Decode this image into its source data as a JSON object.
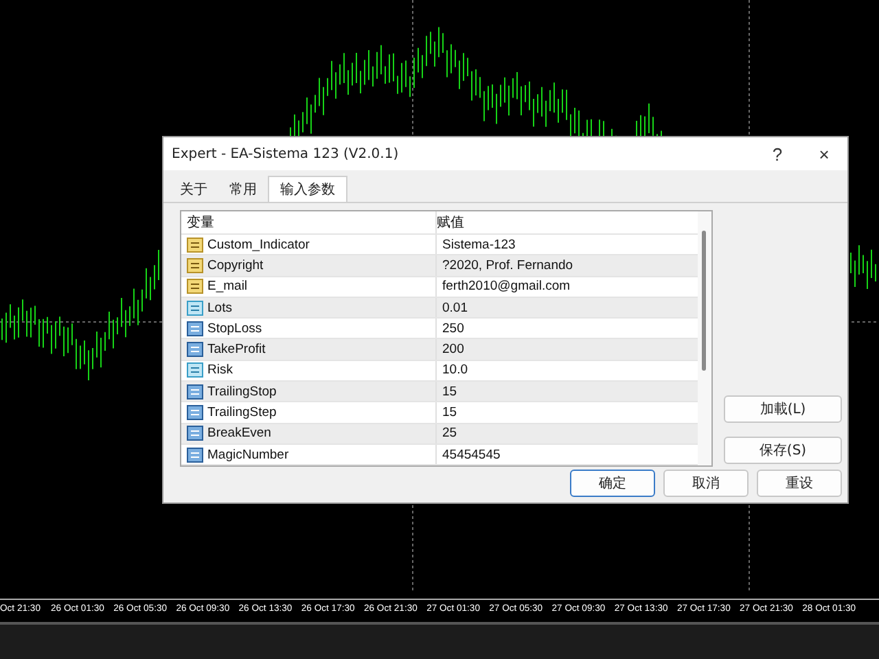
{
  "chart": {
    "time_labels": [
      "Oct 21:30",
      "26 Oct 01:30",
      "26 Oct 05:30",
      "26 Oct 09:30",
      "26 Oct 13:30",
      "26 Oct 17:30",
      "26 Oct 21:30",
      "27 Oct 01:30",
      "27 Oct 05:30",
      "27 Oct 09:30",
      "27 Oct 13:30",
      "27 Oct 17:30",
      "27 Oct 21:30",
      "28 Oct 01:30"
    ]
  },
  "window": {
    "title": "Expert - EA-Sistema 123 (V2.0.1)",
    "help": "?",
    "close": "×"
  },
  "tabs": [
    {
      "label": "关于",
      "selected": false
    },
    {
      "label": "常用",
      "selected": false
    },
    {
      "label": "输入参数",
      "selected": true
    }
  ],
  "table": {
    "columns": [
      "变量",
      "赋值"
    ],
    "rows": [
      {
        "kind": "string",
        "name": "Custom_Indicator",
        "value": "Sistema-123"
      },
      {
        "kind": "string",
        "name": "Copyright",
        "value": "?2020, Prof. Fernando"
      },
      {
        "kind": "string",
        "name": "E_mail",
        "value": "ferth2010@gmail.com"
      },
      {
        "kind": "double",
        "name": "Lots",
        "value": "0.01"
      },
      {
        "kind": "int",
        "name": "StopLoss",
        "value": "250"
      },
      {
        "kind": "int",
        "name": "TakeProfit",
        "value": "200"
      },
      {
        "kind": "double",
        "name": "Risk",
        "value": "10.0"
      },
      {
        "kind": "int",
        "name": "TrailingStop",
        "value": "15"
      },
      {
        "kind": "int",
        "name": "TrailingStep",
        "value": "15"
      },
      {
        "kind": "int",
        "name": "BreakEven",
        "value": "25"
      },
      {
        "kind": "int",
        "name": "MagicNumber",
        "value": "45454545"
      }
    ]
  },
  "side_buttons": [
    "加載(L)",
    "保存(S)"
  ],
  "buttons": [
    {
      "label": "确定",
      "default": true
    },
    {
      "label": "取消",
      "default": false
    },
    {
      "label": "重设",
      "default": false
    }
  ]
}
